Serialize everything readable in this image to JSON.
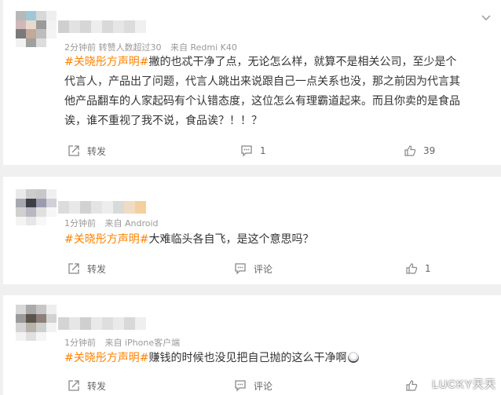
{
  "comments": [
    {
      "meta_time": "2分钟前",
      "meta_extra": "转赞人数超过30",
      "meta_source": "来自 Redmi K40",
      "hashtag": "#关晓彤方声明#",
      "body": "撇的也忒干净了点，无论怎么样，就算不是相关公司，至少是个代言人，产品出了问题，代言人跳出来说跟自己一点关系也没，那之前因为代言其他产品翻车的人家起码有个认错态度，这位怎么有理霸道起来。而且你卖的是食品诶，谁不重视了我不说，食品诶？！！？",
      "repost_label": "转发",
      "comment_count": "1",
      "like_count": "39"
    },
    {
      "meta_time": "1分钟前",
      "meta_source": "来自 Android",
      "hashtag": "#关晓彤方声明#",
      "body": "大难临头各自飞，是这个意思吗？",
      "repost_label": "转发",
      "comment_label": "评论",
      "like_count": "1"
    },
    {
      "meta_time": "1分钟前",
      "meta_source": "来自 iPhone客户端",
      "hashtag": "#关晓彤方声明#",
      "body": "赚钱的时候也没见把自己抛的这么干净啊",
      "repost_label": "转发",
      "comment_label": "评论"
    }
  ],
  "watermark": "LUCKY天天",
  "icons": {
    "repost": "repost-icon",
    "comment": "comment-icon",
    "like": "like-icon",
    "more": "chevron-down-icon",
    "emoji": "emoji-icon"
  }
}
